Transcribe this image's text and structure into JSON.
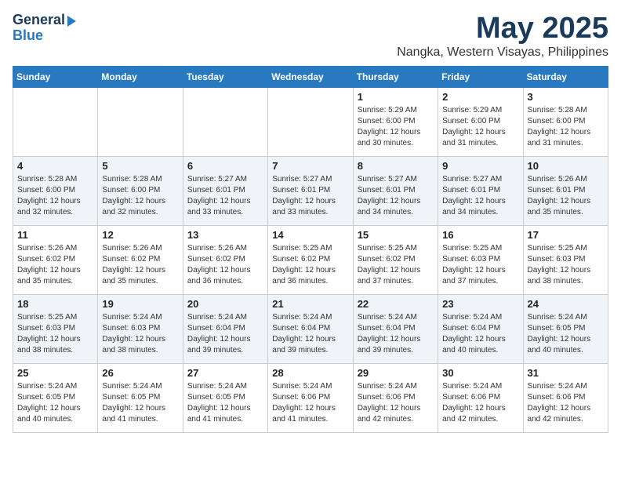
{
  "header": {
    "logo_general": "General",
    "logo_blue": "Blue",
    "title": "May 2025",
    "subtitle": "Nangka, Western Visayas, Philippines"
  },
  "weekdays": [
    "Sunday",
    "Monday",
    "Tuesday",
    "Wednesday",
    "Thursday",
    "Friday",
    "Saturday"
  ],
  "weeks": [
    [
      {
        "day": "",
        "sunrise": "",
        "sunset": "",
        "daylight": ""
      },
      {
        "day": "",
        "sunrise": "",
        "sunset": "",
        "daylight": ""
      },
      {
        "day": "",
        "sunrise": "",
        "sunset": "",
        "daylight": ""
      },
      {
        "day": "",
        "sunrise": "",
        "sunset": "",
        "daylight": ""
      },
      {
        "day": "1",
        "sunrise": "Sunrise: 5:29 AM",
        "sunset": "Sunset: 6:00 PM",
        "daylight": "Daylight: 12 hours and 30 minutes."
      },
      {
        "day": "2",
        "sunrise": "Sunrise: 5:29 AM",
        "sunset": "Sunset: 6:00 PM",
        "daylight": "Daylight: 12 hours and 31 minutes."
      },
      {
        "day": "3",
        "sunrise": "Sunrise: 5:28 AM",
        "sunset": "Sunset: 6:00 PM",
        "daylight": "Daylight: 12 hours and 31 minutes."
      }
    ],
    [
      {
        "day": "4",
        "sunrise": "Sunrise: 5:28 AM",
        "sunset": "Sunset: 6:00 PM",
        "daylight": "Daylight: 12 hours and 32 minutes."
      },
      {
        "day": "5",
        "sunrise": "Sunrise: 5:28 AM",
        "sunset": "Sunset: 6:00 PM",
        "daylight": "Daylight: 12 hours and 32 minutes."
      },
      {
        "day": "6",
        "sunrise": "Sunrise: 5:27 AM",
        "sunset": "Sunset: 6:01 PM",
        "daylight": "Daylight: 12 hours and 33 minutes."
      },
      {
        "day": "7",
        "sunrise": "Sunrise: 5:27 AM",
        "sunset": "Sunset: 6:01 PM",
        "daylight": "Daylight: 12 hours and 33 minutes."
      },
      {
        "day": "8",
        "sunrise": "Sunrise: 5:27 AM",
        "sunset": "Sunset: 6:01 PM",
        "daylight": "Daylight: 12 hours and 34 minutes."
      },
      {
        "day": "9",
        "sunrise": "Sunrise: 5:27 AM",
        "sunset": "Sunset: 6:01 PM",
        "daylight": "Daylight: 12 hours and 34 minutes."
      },
      {
        "day": "10",
        "sunrise": "Sunrise: 5:26 AM",
        "sunset": "Sunset: 6:01 PM",
        "daylight": "Daylight: 12 hours and 35 minutes."
      }
    ],
    [
      {
        "day": "11",
        "sunrise": "Sunrise: 5:26 AM",
        "sunset": "Sunset: 6:02 PM",
        "daylight": "Daylight: 12 hours and 35 minutes."
      },
      {
        "day": "12",
        "sunrise": "Sunrise: 5:26 AM",
        "sunset": "Sunset: 6:02 PM",
        "daylight": "Daylight: 12 hours and 35 minutes."
      },
      {
        "day": "13",
        "sunrise": "Sunrise: 5:26 AM",
        "sunset": "Sunset: 6:02 PM",
        "daylight": "Daylight: 12 hours and 36 minutes."
      },
      {
        "day": "14",
        "sunrise": "Sunrise: 5:25 AM",
        "sunset": "Sunset: 6:02 PM",
        "daylight": "Daylight: 12 hours and 36 minutes."
      },
      {
        "day": "15",
        "sunrise": "Sunrise: 5:25 AM",
        "sunset": "Sunset: 6:02 PM",
        "daylight": "Daylight: 12 hours and 37 minutes."
      },
      {
        "day": "16",
        "sunrise": "Sunrise: 5:25 AM",
        "sunset": "Sunset: 6:03 PM",
        "daylight": "Daylight: 12 hours and 37 minutes."
      },
      {
        "day": "17",
        "sunrise": "Sunrise: 5:25 AM",
        "sunset": "Sunset: 6:03 PM",
        "daylight": "Daylight: 12 hours and 38 minutes."
      }
    ],
    [
      {
        "day": "18",
        "sunrise": "Sunrise: 5:25 AM",
        "sunset": "Sunset: 6:03 PM",
        "daylight": "Daylight: 12 hours and 38 minutes."
      },
      {
        "day": "19",
        "sunrise": "Sunrise: 5:24 AM",
        "sunset": "Sunset: 6:03 PM",
        "daylight": "Daylight: 12 hours and 38 minutes."
      },
      {
        "day": "20",
        "sunrise": "Sunrise: 5:24 AM",
        "sunset": "Sunset: 6:04 PM",
        "daylight": "Daylight: 12 hours and 39 minutes."
      },
      {
        "day": "21",
        "sunrise": "Sunrise: 5:24 AM",
        "sunset": "Sunset: 6:04 PM",
        "daylight": "Daylight: 12 hours and 39 minutes."
      },
      {
        "day": "22",
        "sunrise": "Sunrise: 5:24 AM",
        "sunset": "Sunset: 6:04 PM",
        "daylight": "Daylight: 12 hours and 39 minutes."
      },
      {
        "day": "23",
        "sunrise": "Sunrise: 5:24 AM",
        "sunset": "Sunset: 6:04 PM",
        "daylight": "Daylight: 12 hours and 40 minutes."
      },
      {
        "day": "24",
        "sunrise": "Sunrise: 5:24 AM",
        "sunset": "Sunset: 6:05 PM",
        "daylight": "Daylight: 12 hours and 40 minutes."
      }
    ],
    [
      {
        "day": "25",
        "sunrise": "Sunrise: 5:24 AM",
        "sunset": "Sunset: 6:05 PM",
        "daylight": "Daylight: 12 hours and 40 minutes."
      },
      {
        "day": "26",
        "sunrise": "Sunrise: 5:24 AM",
        "sunset": "Sunset: 6:05 PM",
        "daylight": "Daylight: 12 hours and 41 minutes."
      },
      {
        "day": "27",
        "sunrise": "Sunrise: 5:24 AM",
        "sunset": "Sunset: 6:05 PM",
        "daylight": "Daylight: 12 hours and 41 minutes."
      },
      {
        "day": "28",
        "sunrise": "Sunrise: 5:24 AM",
        "sunset": "Sunset: 6:06 PM",
        "daylight": "Daylight: 12 hours and 41 minutes."
      },
      {
        "day": "29",
        "sunrise": "Sunrise: 5:24 AM",
        "sunset": "Sunset: 6:06 PM",
        "daylight": "Daylight: 12 hours and 42 minutes."
      },
      {
        "day": "30",
        "sunrise": "Sunrise: 5:24 AM",
        "sunset": "Sunset: 6:06 PM",
        "daylight": "Daylight: 12 hours and 42 minutes."
      },
      {
        "day": "31",
        "sunrise": "Sunrise: 5:24 AM",
        "sunset": "Sunset: 6:06 PM",
        "daylight": "Daylight: 12 hours and 42 minutes."
      }
    ]
  ]
}
